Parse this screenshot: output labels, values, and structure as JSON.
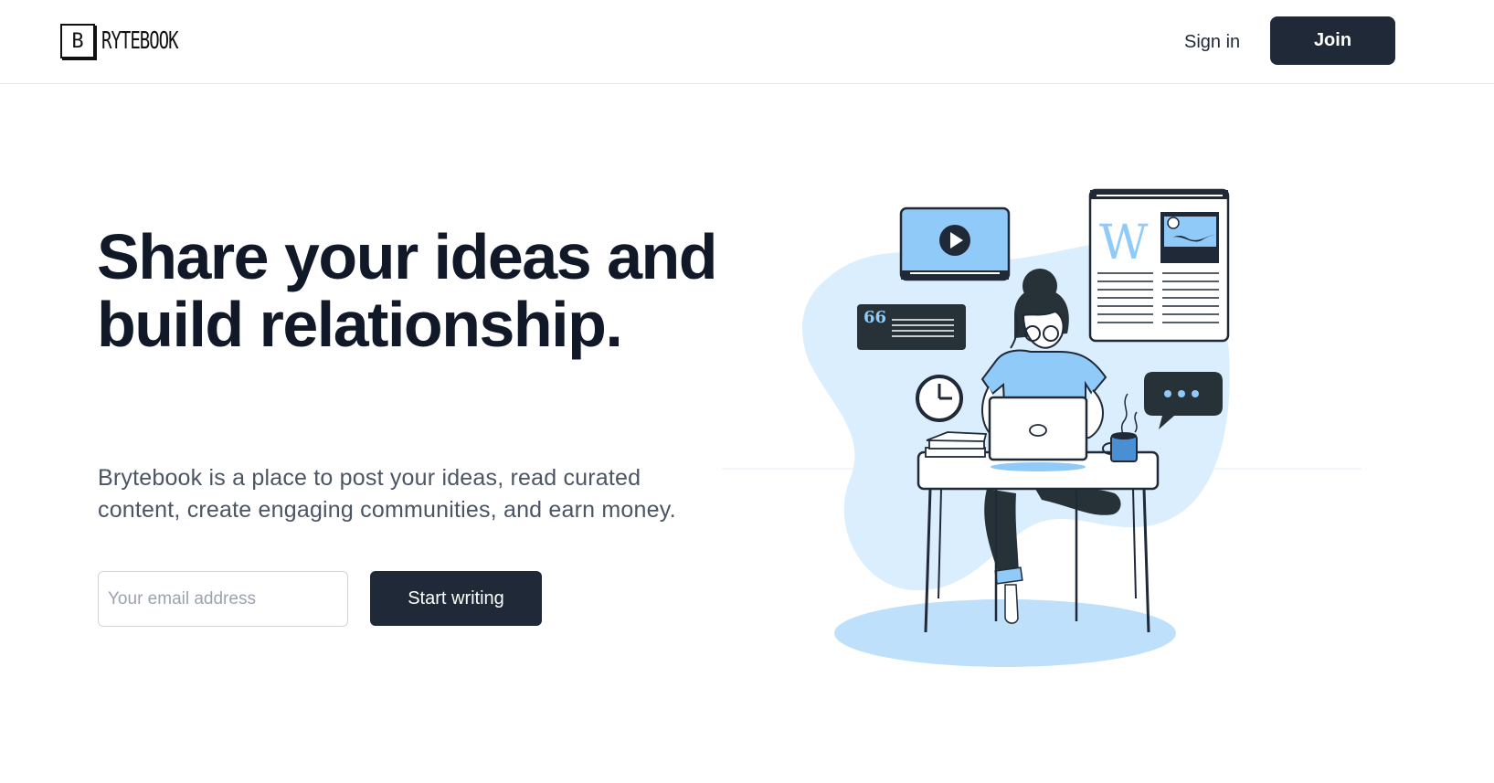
{
  "brand": {
    "logo_letter": "B",
    "name": "RYTEBOOK"
  },
  "nav": {
    "signin_label": "Sign in",
    "join_label": "Join"
  },
  "hero": {
    "title": "Share your ideas and build relationship.",
    "subtitle": "Brytebook is a place to post your ideas, read curated content, create engaging communities, and earn money.",
    "email_placeholder": "Your email address",
    "cta_label": "Start writing"
  },
  "illustration": {
    "article_letter": "W",
    "quote_mark": "66",
    "icons": [
      "play-icon",
      "clock-icon",
      "chat-bubble-icon",
      "quote-icon",
      "image-icon"
    ]
  },
  "colors": {
    "primary_dark": "#1f2937",
    "accent_blue": "#90caf9",
    "light_blue": "#dbeefd",
    "text_muted": "#4b5563"
  }
}
